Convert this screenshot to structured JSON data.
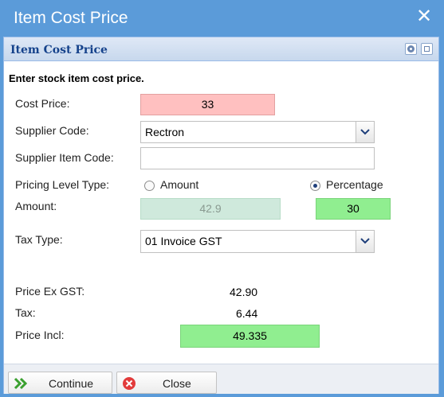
{
  "window": {
    "title": "Item Cost Price",
    "close_glyph": "✕"
  },
  "panel": {
    "title": "Item Cost Price"
  },
  "form": {
    "instruction": "Enter stock item cost price.",
    "cost_price": {
      "label": "Cost Price:",
      "value": "33"
    },
    "supplier_code": {
      "label": "Supplier Code:",
      "value": "Rectron"
    },
    "supplier_item_code": {
      "label": "Supplier Item Code:",
      "value": ""
    },
    "pricing_level_type": {
      "label": "Pricing Level Type:",
      "options": [
        "Amount",
        "Percentage"
      ],
      "selected": "Percentage"
    },
    "amount": {
      "label": "Amount:",
      "amount_value": "42.9",
      "percentage_value": "30"
    },
    "tax_type": {
      "label": "Tax Type:",
      "value": "01 Invoice GST"
    }
  },
  "summary": {
    "price_ex_gst": {
      "label": "Price Ex GST:",
      "value": "42.90"
    },
    "tax": {
      "label": "Tax:",
      "value": "6.44"
    },
    "price_incl": {
      "label": "Price Incl:",
      "value": "49.335"
    }
  },
  "buttons": {
    "continue": "Continue",
    "close": "Close"
  },
  "icons": {
    "close": "close-icon",
    "gear": "gear-icon",
    "expand": "expand-icon",
    "continue": "double-chevron-right-icon",
    "close_button": "red-x-circle-icon",
    "dropdown": "chevron-down-icon"
  },
  "colors": {
    "titlebar": "#5b9bd9",
    "cost_price_bg": "#ffc0c0",
    "amount_bg": "#cfe9dc",
    "highlight_green": "#90ee90",
    "panel_title": "#15428b"
  }
}
